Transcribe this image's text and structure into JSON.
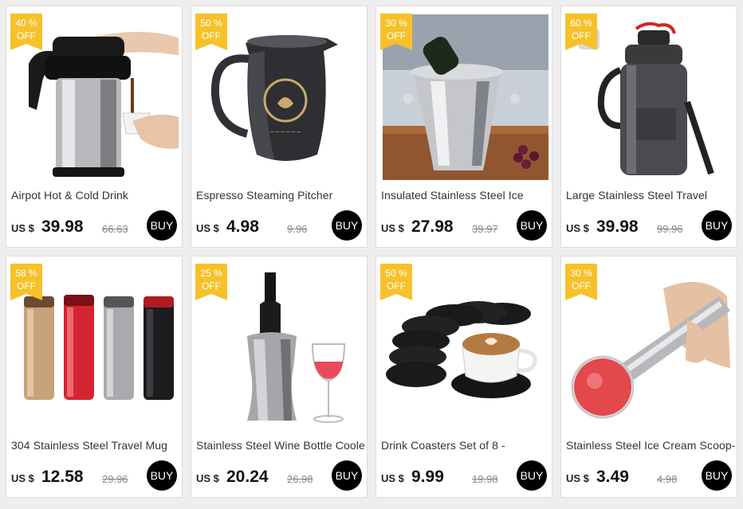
{
  "products": [
    {
      "title": "Airpot Hot & Cold Drink",
      "currency": "US $",
      "price": "39.98",
      "old_price": "66.63",
      "discount": "40  %",
      "off": "OFF",
      "buy": "BUY"
    },
    {
      "title": "Espresso Steaming Pitcher",
      "currency": "US $",
      "price": "4.98",
      "old_price": "9.96",
      "discount": "50  %",
      "off": "OFF",
      "buy": "BUY"
    },
    {
      "title": "Insulated Stainless Steel Ice",
      "currency": "US $",
      "price": "27.98",
      "old_price": "39.97",
      "discount": "30  %",
      "off": "OFF",
      "buy": "BUY"
    },
    {
      "title": "Large Stainless Steel Travel",
      "currency": "US $",
      "price": "39.98",
      "old_price": "99.96",
      "discount": "60  %",
      "off": "OFF",
      "buy": "BUY"
    },
    {
      "title": "304 Stainless Steel Travel Mug",
      "currency": "US $",
      "price": "12.58",
      "old_price": "29.96",
      "discount": "58  %",
      "off": "OFF",
      "buy": "BUY"
    },
    {
      "title": "Stainless Steel Wine Bottle Cooler",
      "currency": "US $",
      "price": "20.24",
      "old_price": "26.98",
      "discount": "25  %",
      "off": "OFF",
      "buy": "BUY"
    },
    {
      "title": "Drink Coasters Set of 8 -",
      "currency": "US $",
      "price": "9.99",
      "old_price": "19.98",
      "discount": "50  %",
      "off": "OFF",
      "buy": "BUY"
    },
    {
      "title": "Stainless Steel Ice Cream Scoop-",
      "currency": "US $",
      "price": "3.49",
      "old_price": "4.98",
      "discount": "30  %",
      "off": "OFF",
      "buy": "BUY"
    }
  ],
  "colors": {
    "badge": "#f6c12a",
    "buy_button": "#000000",
    "background": "#eeeeee"
  }
}
